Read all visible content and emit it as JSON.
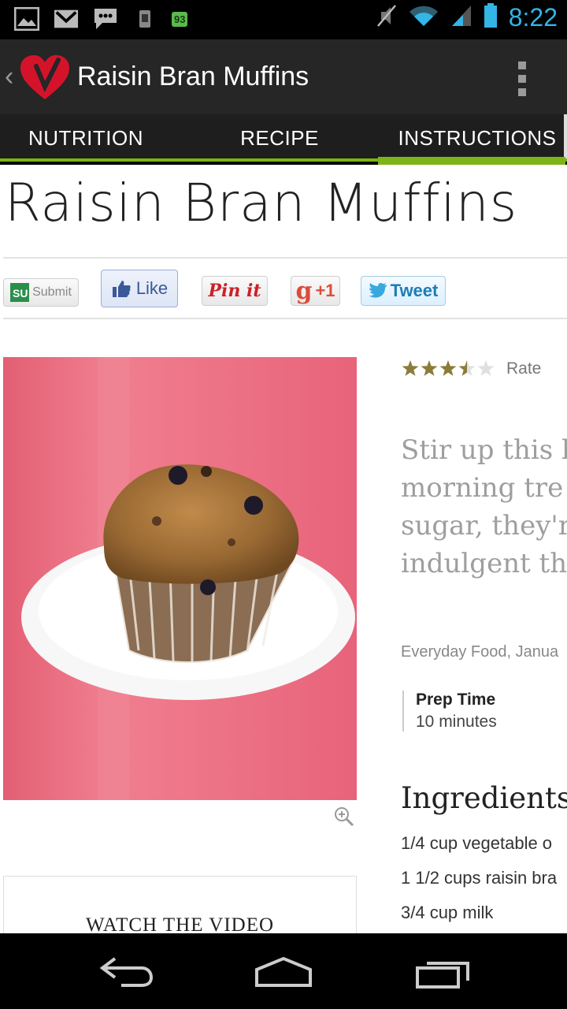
{
  "status_bar": {
    "time": "8:22",
    "battery_percent": "93",
    "left_icons": [
      "gallery-icon",
      "gmail-icon",
      "messaging-icon",
      "sim-icon",
      "battery-badge"
    ],
    "right_icons": [
      "mute-icon",
      "wifi-icon",
      "signal-icon",
      "battery-icon"
    ]
  },
  "action_bar": {
    "title": "Raisin Bran Muffins",
    "back_glyph": "‹"
  },
  "tabs": [
    {
      "label": "NUTRITION",
      "active": false
    },
    {
      "label": "RECIPE",
      "active": false
    },
    {
      "label": "INSTRUCTIONS",
      "active": true
    }
  ],
  "recipe": {
    "title": "Raisin Bran Muffins",
    "rating_stars": 3.5,
    "rating_max": 5,
    "rate_label": "Rate",
    "description_lines": [
      "Stir up this b",
      "morning tre",
      "sugar, they'r",
      "indulgent th"
    ],
    "source": "Everyday Food, Janua",
    "prep_label": "Prep Time",
    "prep_value": "10 minutes",
    "ingredients_title": "Ingredients",
    "ingredients": [
      "1/4 cup vegetable o",
      "1 1/2 cups raisin bra",
      "3/4 cup milk"
    ],
    "video_label": "WATCH THE VIDEO"
  },
  "share": {
    "stumble": "Submit",
    "facebook": "Like",
    "pinterest": "Pin it",
    "gplus": "+1",
    "twitter": "Tweet"
  },
  "colors": {
    "accent_green": "#7cb518",
    "status_blue": "#33b5e5",
    "brand_red": "#d4132a"
  }
}
